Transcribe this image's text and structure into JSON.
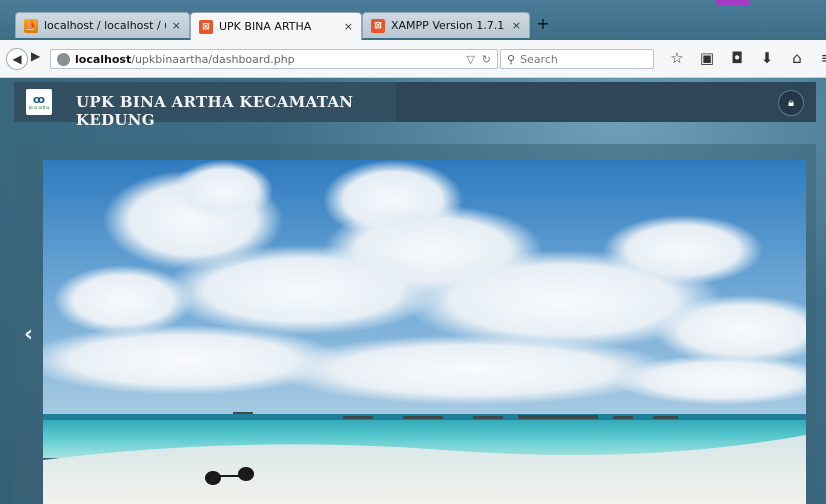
{
  "browser": {
    "tabs": [
      {
        "label": "localhost / localhost / upk...",
        "icon": "phpmyadmin-icon",
        "active": false
      },
      {
        "label": "UPK BINA ARTHA",
        "icon": "xampp-icon",
        "active": true
      },
      {
        "label": "XAMPP Version 1.7.1",
        "icon": "xampp-icon",
        "active": false
      }
    ],
    "close_glyph": "×",
    "new_tab_glyph": "+",
    "url": {
      "host": "localhost",
      "path": "/upkbinaartha/dashboard.php"
    },
    "search_placeholder": "Search"
  },
  "app": {
    "title": "UPK BINA ARTHA KECAMATAN KEDUNG",
    "logo_sub": "bina artha"
  },
  "carousel": {
    "prev_glyph": "‹",
    "next_glyph": "›"
  },
  "colors": {
    "header_bg": "#2e4758",
    "page_bg": "#3d6e86",
    "active_tab": "#f4f6f8"
  }
}
